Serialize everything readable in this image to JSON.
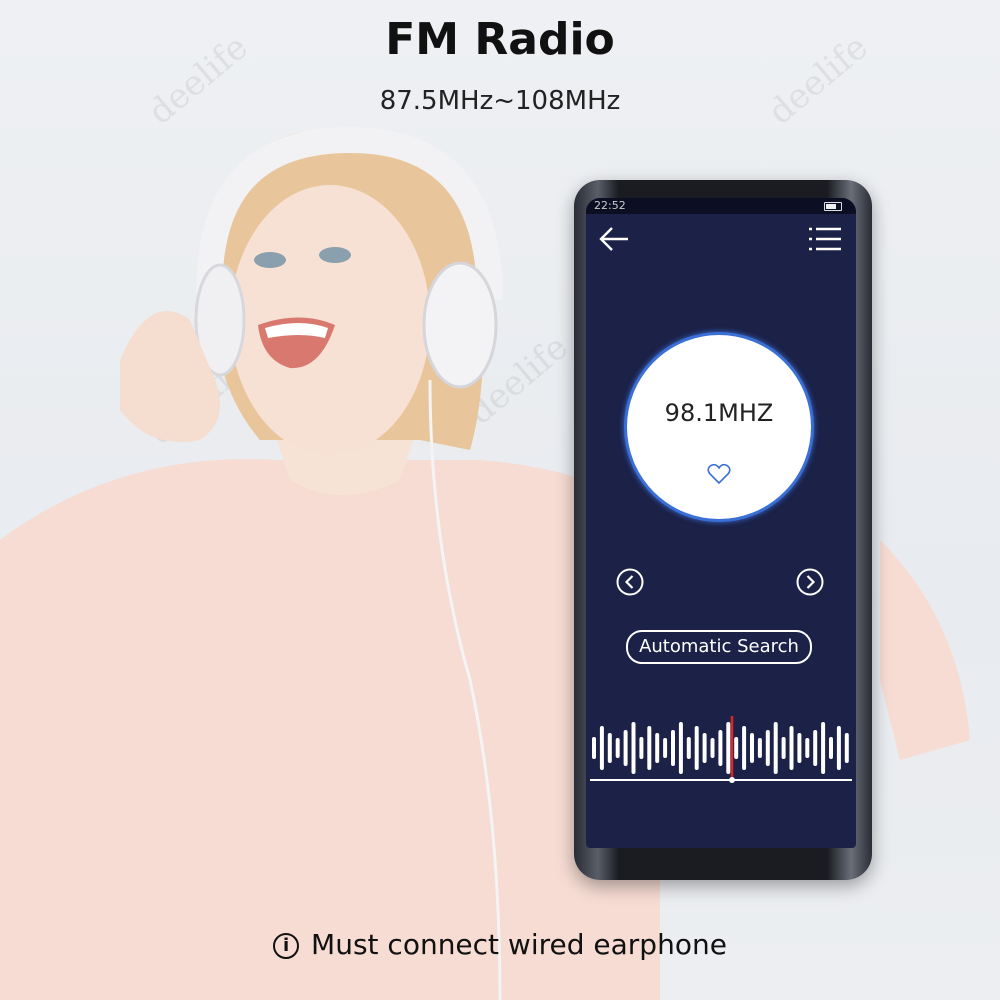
{
  "header": {
    "title": "FM Radio",
    "subtitle": "87.5MHz~108MHz"
  },
  "watermark": "deelife",
  "device": {
    "status_time": "22:52",
    "frequency": "98.1MHZ",
    "search_button": "Automatic Search",
    "icons": [
      "back-arrow-icon",
      "menu-list-icon",
      "heart-icon",
      "chevron-left-icon",
      "chevron-right-icon",
      "battery-icon"
    ],
    "accent_color": "#3a6fd6",
    "screen_color": "#1b2147",
    "tuner_marker_color": "#d8262a"
  },
  "footer": {
    "caption": "Must connect wired earphone",
    "icon": "info-icon"
  }
}
